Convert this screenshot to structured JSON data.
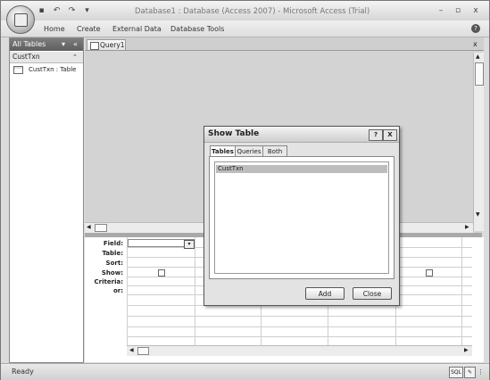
{
  "window": {
    "title": "Database1 : Database (Access 2007) - Microsoft Access (Trial)",
    "controls": {
      "minimize": "–",
      "restore": "▫",
      "close": "x"
    }
  },
  "quick_access": {
    "save_icon": "save-icon",
    "undo_icon": "undo-icon",
    "redo_icon": "redo-icon",
    "customize_icon": "dropdown-icon"
  },
  "ribbon": {
    "tabs": [
      "Home",
      "Create",
      "External Data",
      "Database Tools"
    ],
    "help": "?"
  },
  "nav_pane": {
    "header": "All Tables",
    "group": "CustTxn",
    "items": [
      {
        "label": "CustTxn : Table"
      }
    ]
  },
  "document": {
    "tab_label": "Query1",
    "close": "x"
  },
  "design_grid": {
    "row_labels": [
      "Field:",
      "Table:",
      "Sort:",
      "Show:",
      "Criteria:",
      "or:"
    ]
  },
  "dialog": {
    "title": "Show Table",
    "help_button": "?",
    "close_button": "X",
    "tabs": [
      "Tables",
      "Queries",
      "Both"
    ],
    "active_tab": "Tables",
    "list_items": [
      "CustTxn"
    ],
    "add_label": "Add",
    "close_label": "Close"
  },
  "status": {
    "text": "Ready",
    "sql_label": "SQL"
  },
  "colors": {
    "selection": "#bdbdbd",
    "nav_header": "#6b6b6b",
    "workspace": "#d3d3d3"
  }
}
